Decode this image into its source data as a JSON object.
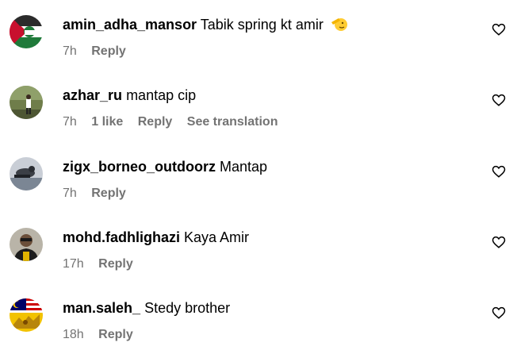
{
  "comments": [
    {
      "username": "amin_adha_mansor",
      "text": "Tabik spring kt amir",
      "emoji": "saluting-face-emoji",
      "time": "7h",
      "likes": "",
      "reply": "Reply",
      "translation": ""
    },
    {
      "username": "azhar_ru",
      "text": "mantap cip",
      "time": "7h",
      "likes": "1 like",
      "reply": "Reply",
      "translation": "See translation"
    },
    {
      "username": "zigx_borneo_outdoorz",
      "text": "Mantap",
      "time": "7h",
      "likes": "",
      "reply": "Reply",
      "translation": ""
    },
    {
      "username": "mohd.fadhlighazi",
      "text": "Kaya Amir",
      "time": "17h",
      "likes": "",
      "reply": "Reply",
      "translation": ""
    },
    {
      "username": "man.saleh_",
      "text": "Stedy brother",
      "time": "18h",
      "likes": "",
      "reply": "Reply",
      "translation": ""
    }
  ],
  "icons": {
    "like": "heart-outline-icon"
  },
  "colors": {
    "meta_text": "#737373",
    "text": "#000000",
    "background": "#ffffff"
  }
}
